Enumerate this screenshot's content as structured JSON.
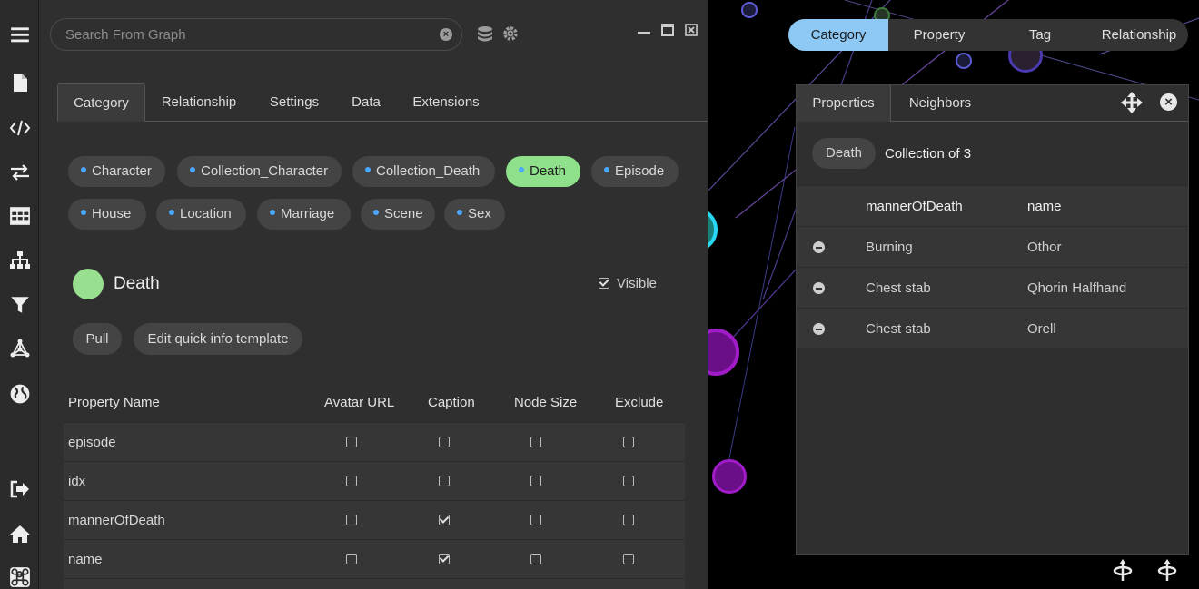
{
  "search": {
    "placeholder": "Search From Graph",
    "clear_icon": "clear-icon"
  },
  "sidebar_icons": [
    "menu-icon",
    "file-icon",
    "code-icon",
    "swap-icon",
    "table-icon",
    "hierarchy-icon",
    "filter-icon",
    "network-icon",
    "globe-icon",
    "logout-icon",
    "home-icon",
    "command-icon"
  ],
  "tabs": [
    "Category",
    "Relationship",
    "Settings",
    "Data",
    "Extensions"
  ],
  "active_tab": "Category",
  "categories": [
    "Character",
    "Collection_Character",
    "Collection_Death",
    "Death",
    "Episode",
    "House",
    "Location",
    "Marriage",
    "Scene",
    "Sex"
  ],
  "selected_category": {
    "name": "Death",
    "color": "#98e08f",
    "visible_label": "Visible",
    "pull_label": "Pull",
    "edit_template_label": "Edit quick info template"
  },
  "property_table": {
    "headers": [
      "Property Name",
      "Avatar URL",
      "Caption",
      "Node Size",
      "Exclude"
    ],
    "rows": [
      {
        "name": "episode",
        "avatar": false,
        "caption": false,
        "size": false,
        "exclude": false
      },
      {
        "name": "idx",
        "avatar": false,
        "caption": false,
        "size": false,
        "exclude": false
      },
      {
        "name": "mannerOfDeath",
        "avatar": false,
        "caption": true,
        "size": false,
        "exclude": false
      },
      {
        "name": "name",
        "avatar": false,
        "caption": true,
        "size": false,
        "exclude": false
      }
    ]
  },
  "graph_tabs": [
    "Category",
    "Property",
    "Tag",
    "Relationship"
  ],
  "graph_active_tab": "Category",
  "popup": {
    "tabs": [
      "Properties",
      "Neighbors"
    ],
    "chip": "Death",
    "collection_label": "Collection of 3",
    "columns": [
      "mannerOfDeath",
      "name"
    ],
    "rows": [
      {
        "manner": "Burning",
        "name": "Othor"
      },
      {
        "manner": "Chest stab",
        "name": "Qhorin Halfhand"
      },
      {
        "manner": "Chest stab",
        "name": "Orell"
      }
    ]
  },
  "colors": {
    "accent_green": "#8ee08a",
    "accent_blue": "#8ec9f5",
    "dot_blue": "#4aa8ff"
  }
}
